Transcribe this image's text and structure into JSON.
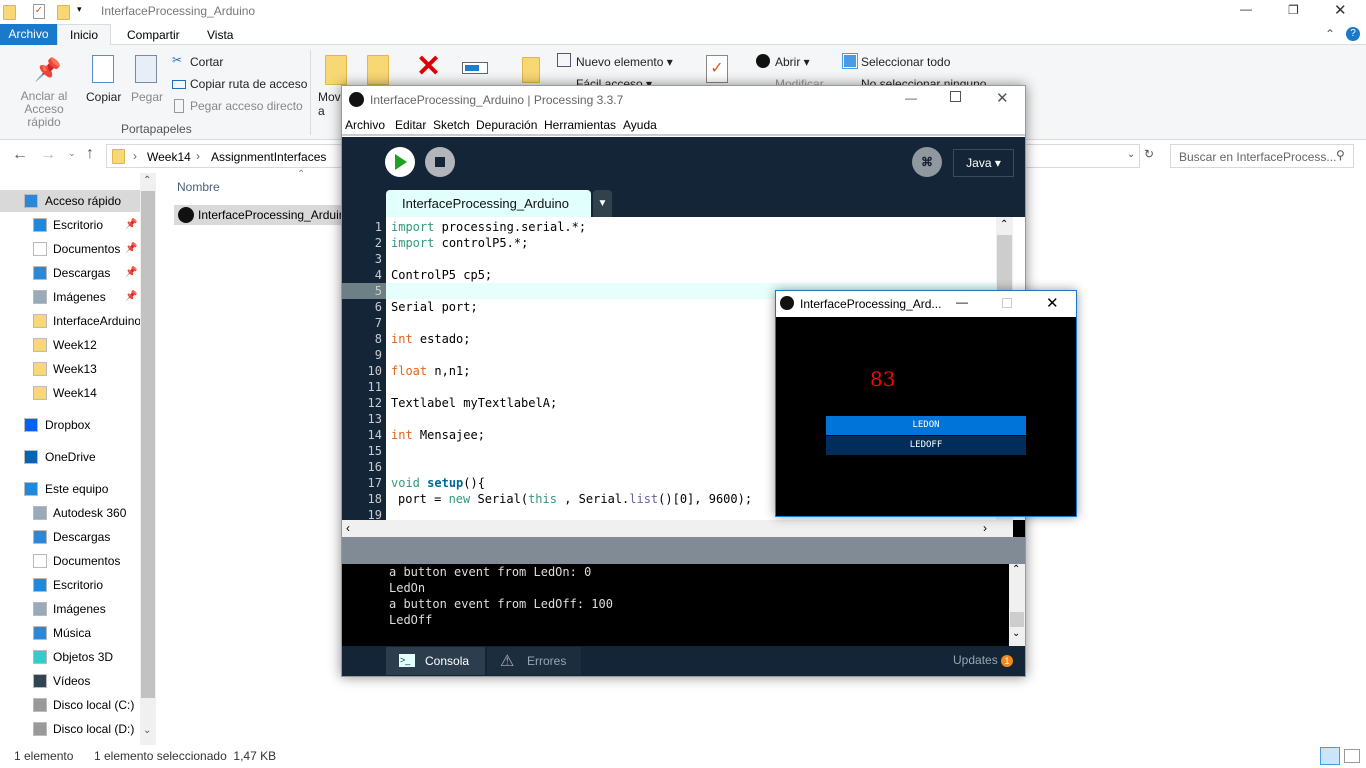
{
  "explorer": {
    "title": "InterfaceProcessing_Arduino",
    "tabs": [
      "Archivo",
      "Inicio",
      "Compartir",
      "Vista"
    ],
    "ribbon": {
      "pin": "Anclar al Acceso rápido",
      "copy": "Copiar",
      "paste": "Pegar",
      "cut": "Cortar",
      "copy_path": "Copiar ruta de acceso",
      "paste_shortcut": "Pegar acceso directo",
      "group": "Portapapeles",
      "move": "Mover a",
      "new_item": "Nuevo elemento",
      "easy_access": "Fácil acceso",
      "open": "Abrir",
      "modify": "Modificar",
      "select_all": "Seleccionar todo",
      "select_none": "No seleccionar ninguno"
    },
    "breadcrumb": [
      "Week14",
      "AssignmentInterfaces"
    ],
    "search_placeholder": "Buscar en InterfaceProcess...",
    "column_name": "Nombre",
    "files": [
      "InterfaceProcessing_Arduino"
    ],
    "nav": [
      {
        "label": "Acceso rápido",
        "top": true,
        "icon": "star-icon"
      },
      {
        "label": "Escritorio",
        "pin": true,
        "icon": "desktop-icon"
      },
      {
        "label": "Documentos",
        "pin": true,
        "icon": "documents-icon"
      },
      {
        "label": "Descargas",
        "pin": true,
        "icon": "download-icon"
      },
      {
        "label": "Imágenes",
        "pin": true,
        "icon": "pictures-icon"
      },
      {
        "label": "InterfaceArduino",
        "icon": "folder-icon"
      },
      {
        "label": "Week12",
        "icon": "folder-icon"
      },
      {
        "label": "Week13",
        "icon": "folder-icon"
      },
      {
        "label": "Week14",
        "icon": "folder-icon"
      },
      {
        "label": "Dropbox",
        "top": true,
        "icon": "dropbox-icon"
      },
      {
        "label": "OneDrive",
        "top": true,
        "icon": "cloud-icon"
      },
      {
        "label": "Este equipo",
        "top": true,
        "icon": "computer-icon"
      },
      {
        "label": "Autodesk 360",
        "icon": "autodesk-icon"
      },
      {
        "label": "Descargas",
        "icon": "download-icon"
      },
      {
        "label": "Documentos",
        "icon": "documents-icon"
      },
      {
        "label": "Escritorio",
        "icon": "desktop-icon"
      },
      {
        "label": "Imágenes",
        "icon": "pictures-icon"
      },
      {
        "label": "Música",
        "icon": "music-icon"
      },
      {
        "label": "Objetos 3D",
        "icon": "cube-icon"
      },
      {
        "label": "Vídeos",
        "icon": "video-icon"
      },
      {
        "label": "Disco local (C:)",
        "icon": "drive-icon"
      },
      {
        "label": "Disco local (D:)",
        "icon": "drive-icon"
      }
    ],
    "status": {
      "count": "1 elemento",
      "selected": "1 elemento seleccionado  1,47 KB"
    }
  },
  "processing": {
    "title": "InterfaceProcessing_Arduino | Processing 3.3.7",
    "menu": [
      "Archivo",
      "Editar",
      "Sketch",
      "Depuración",
      "Herramientas",
      "Ayuda"
    ],
    "mode": "Java",
    "tab": "InterfaceProcessing_Arduino",
    "code": [
      [
        [
          "kw",
          "import"
        ],
        [
          "",
          "processing.serial.*;"
        ]
      ],
      [
        [
          "kw",
          "import"
        ],
        [
          "",
          "controlP5.*;"
        ]
      ],
      [],
      [
        [
          "",
          "ControlP5 cp5;"
        ]
      ],
      [],
      [
        [
          "",
          "Serial port;"
        ]
      ],
      [],
      [
        [
          "ty",
          "int"
        ],
        [
          "",
          "estado;"
        ]
      ],
      [],
      [
        [
          "ty",
          "float"
        ],
        [
          "",
          "n,n1;"
        ]
      ],
      [],
      [
        [
          "",
          "Textlabel myTextlabelA;"
        ]
      ],
      [],
      [
        [
          "ty",
          "int"
        ],
        [
          "",
          "Mensajee;"
        ]
      ],
      [],
      [],
      [
        [
          "kw",
          "void"
        ],
        [
          "fn",
          "setup"
        ],
        [
          "",
          "(){"
        ]
      ],
      [
        [
          "",
          "port = "
        ],
        [
          "kw",
          "new"
        ],
        [
          "",
          "Serial("
        ],
        [
          "kw",
          "this"
        ],
        [
          "",
          ", Serial."
        ],
        [
          "bl",
          "list"
        ],
        [
          "",
          "()[0], 9600);"
        ]
      ],
      []
    ],
    "current_line": 5,
    "console": [
      "a button event from LedOn: 0",
      "LedOn",
      "a button event from LedOff: 100",
      "LedOff"
    ],
    "footer": {
      "console": "Consola",
      "errors": "Errores",
      "updates": "Updates",
      "updates_count": "1"
    }
  },
  "sketch": {
    "title": "InterfaceProcessing_Ard...",
    "value": "83",
    "buttons": [
      "LEDON",
      "LEDOFF"
    ]
  }
}
